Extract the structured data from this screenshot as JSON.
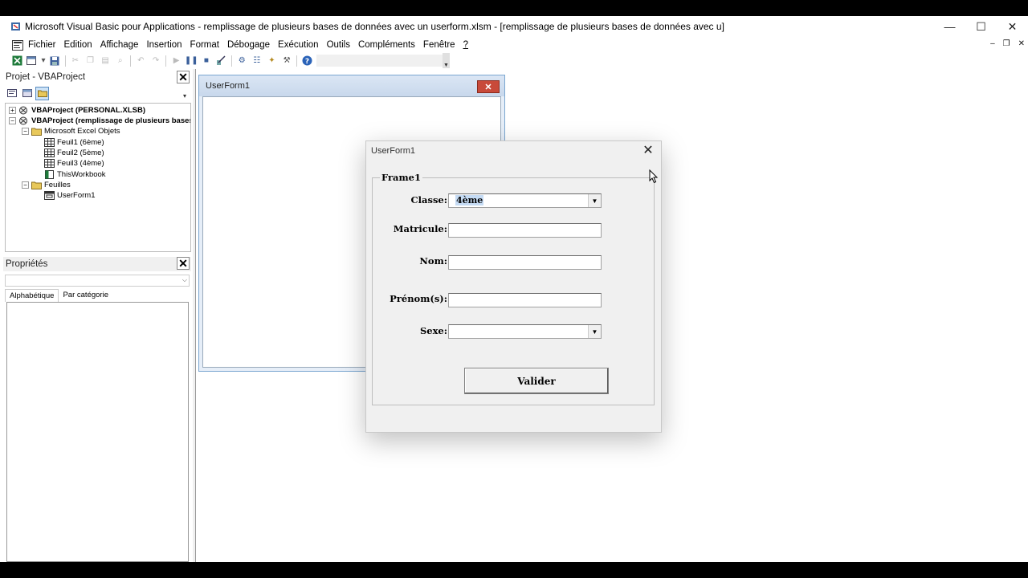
{
  "window": {
    "title": "Microsoft Visual Basic pour Applications - remplissage de plusieurs bases de données avec un userform.xlsm - [remplissage de plusieurs bases de données avec u]",
    "minimize": "—",
    "maximize": "☐",
    "close": "✕"
  },
  "menu": {
    "items": [
      "Fichier",
      "Edition",
      "Affichage",
      "Insertion",
      "Format",
      "Débogage",
      "Exécution",
      "Outils",
      "Compléments",
      "Fenêtre",
      "?"
    ],
    "mdi": {
      "minimize": "–",
      "restore": "❐",
      "close": "✕"
    }
  },
  "project": {
    "title": "Projet - VBAProject",
    "close": "✕",
    "tree": [
      {
        "label": "VBAProject (PERSONAL.XLSB)",
        "bold": true
      },
      {
        "label": "VBAProject (remplissage de plusieurs bases d",
        "bold": true
      },
      {
        "label": "Microsoft Excel Objets"
      },
      {
        "label": "Feuil1 (6ème)"
      },
      {
        "label": "Feuil2 (5ème)"
      },
      {
        "label": "Feuil3 (4ème)"
      },
      {
        "label": "ThisWorkbook"
      },
      {
        "label": "Feuilles"
      },
      {
        "label": "UserForm1"
      }
    ]
  },
  "properties": {
    "title": "Propriétés",
    "close": "✕",
    "tabs": [
      "Alphabétique",
      "Par catégorie"
    ]
  },
  "design_form": {
    "title": "UserForm1",
    "close": "✕"
  },
  "dialog": {
    "title": "UserForm1",
    "close": "✕",
    "frame_caption": "Frame1",
    "fields": {
      "classe_label": "Classe:",
      "classe_value": "4ème",
      "matricule_label": "Matricule:",
      "matricule_value": "",
      "nom_label": "Nom:",
      "nom_value": "",
      "prenom_label": "Prénom(s):",
      "prenom_value": "",
      "sexe_label": "Sexe:",
      "sexe_value": ""
    },
    "button": "Valider"
  },
  "colors": {
    "selection": "#c5dbf4",
    "dialog_bg": "#f0f0f0",
    "design_close": "#c84a3a"
  }
}
